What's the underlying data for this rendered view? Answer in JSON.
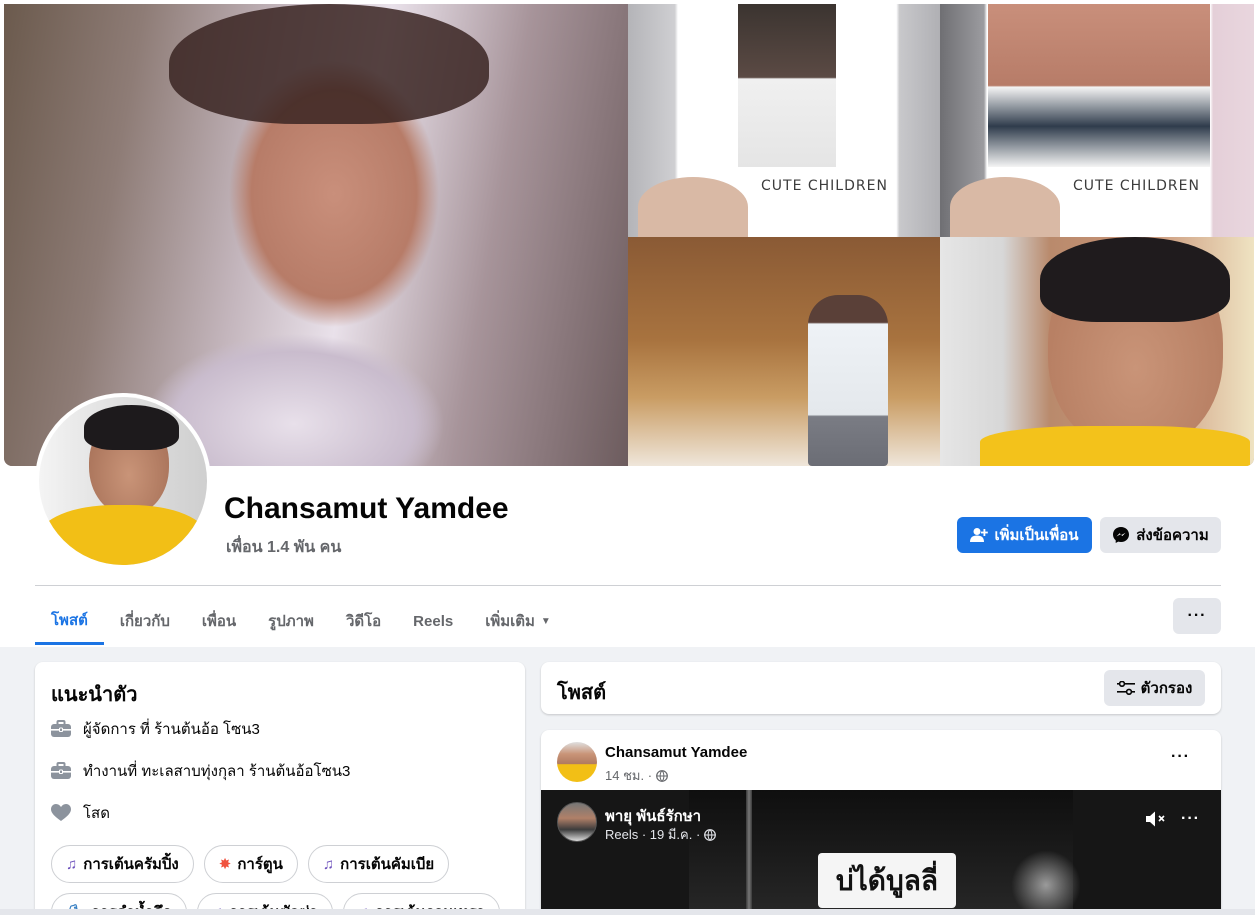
{
  "profile": {
    "cover_tile_caption": "CUTE CHILDREN",
    "name": "Chansamut Yamdee",
    "friends_count": "เพื่อน 1.4 พัน คน",
    "add_friend_label": "เพิ่มเป็นเพื่อน",
    "message_label": "ส่งข้อความ",
    "more_label": "···"
  },
  "tabs": [
    {
      "label": "โพสต์",
      "active": true
    },
    {
      "label": "เกี่ยวกับ"
    },
    {
      "label": "เพื่อน"
    },
    {
      "label": "รูปภาพ"
    },
    {
      "label": "วิดีโอ"
    },
    {
      "label": "Reels"
    },
    {
      "label": "เพิ่มเติม"
    }
  ],
  "intro": {
    "title": "แนะนำตัว",
    "rows": [
      {
        "icon": "briefcase-icon",
        "text": "ผู้จัดการ ที่ ร้านต้นอ้อ โซน3"
      },
      {
        "icon": "briefcase-icon",
        "text": "ทำงานที่ ทะเลสาบทุ่งกุลา ร้านต้นอ้อโซน3"
      },
      {
        "icon": "heart-icon",
        "text": "โสด"
      }
    ],
    "hobbies": [
      {
        "icon": "music-note-icon",
        "label": "การเต้นครัมปิ้ง"
      },
      {
        "icon": "boom-icon",
        "label": "การ์ตูน"
      },
      {
        "icon": "music-note-icon",
        "label": "การเต้นคัมเบีย"
      },
      {
        "icon": "shoe-icon",
        "label": "การดำน้ำลึก"
      },
      {
        "icon": "music-note-icon",
        "label": "การเต้นซัลซ่า"
      },
      {
        "icon": "music-note-icon",
        "label": "การเต้นกวนเหรา"
      }
    ]
  },
  "posts": {
    "title": "โพสต์",
    "filter_label": "ตัวกรอง"
  },
  "post": {
    "author": "Chansamut Yamdee",
    "time": "14 ชม. ·",
    "reel": {
      "author": "พายุ พันธ์รักษา",
      "meta": "Reels · 19 มี.ค. ·",
      "caption": "บ่ได้บูลลี่"
    }
  },
  "colors": {
    "accent": "#1b74e4",
    "background": "#f0f2f5",
    "secondary_text": "#65676b"
  }
}
